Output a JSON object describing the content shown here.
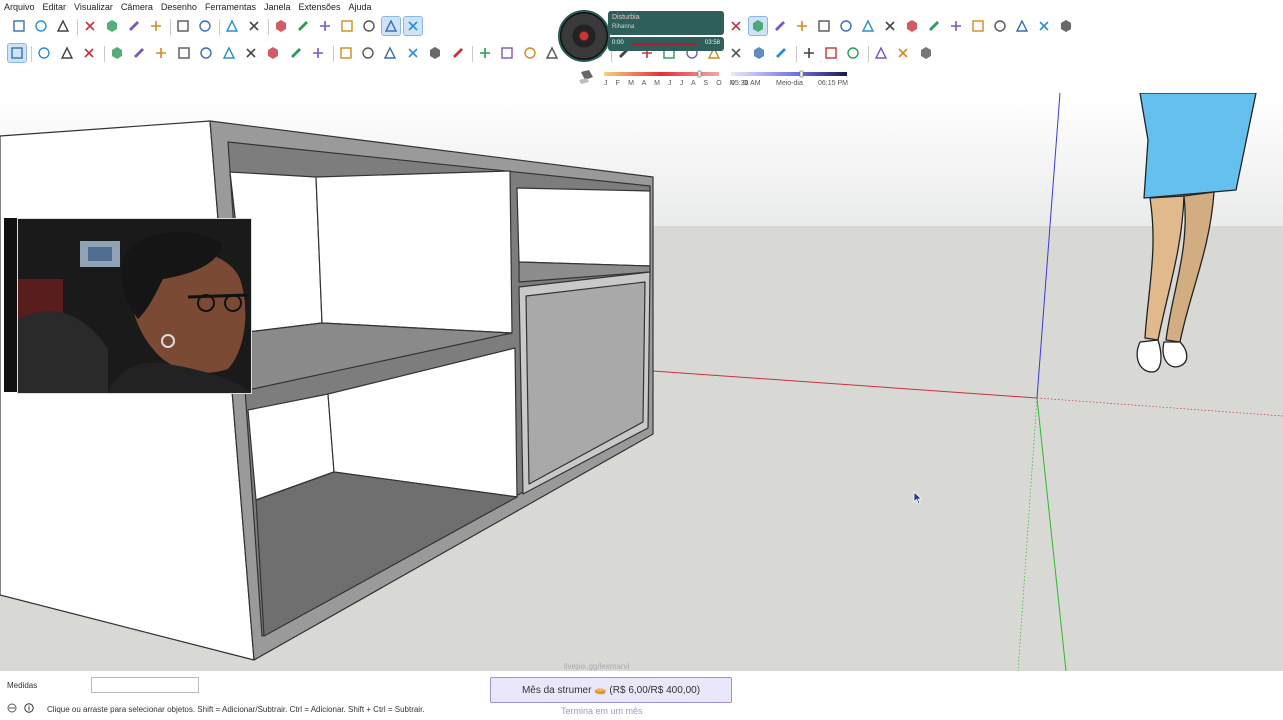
{
  "menu": [
    "Arquivo",
    "Editar",
    "Visualizar",
    "Câmera",
    "Desenho",
    "Ferramentas",
    "Janela",
    "Extensões",
    "Ajuda"
  ],
  "music": {
    "title": "Disturbia",
    "artist": "Rihanna",
    "time_start": "0:00",
    "time_end": "03:58"
  },
  "shadow": {
    "months": "J F M A M J J A S O N D",
    "time_start": "05:38 AM",
    "time_mid": "Meio-dia",
    "time_end": "06:15 PM"
  },
  "status": {
    "measure_label": "Medidas",
    "hint": "Clique ou arraste para selecionar objetos. Shift = Adicionar/Subtrair. Ctrl = Adicionar. Shift + Ctrl = Subtrair."
  },
  "donation": {
    "url": "livepix.gg/lexmarvl",
    "goal": "Mês da strumer 🥧 (R$ 6,00/R$ 400,00)",
    "goal_sub": "Termina em um mês"
  },
  "colors": {
    "red_axis": "#c8323c",
    "green_axis": "#2eb82e",
    "blue_axis": "#3a3ad8",
    "accent": "#cfe3f7"
  },
  "icons": {
    "toolbar_row1": [
      "new-file-icon",
      "open-folder-icon",
      "save-icon",
      "cut-icon",
      "copy-icon",
      "paste-icon",
      "erase-icon",
      "undo-icon",
      "redo-icon",
      "print-icon",
      "model-info-icon",
      "iso-view-icon",
      "top-view-icon",
      "front-view-icon",
      "right-view-icon",
      "back-view-icon",
      "left-view-icon",
      "bottom-view-icon",
      "orbit-icon",
      "pan-icon",
      "zoom-extents-icon",
      "section-icon",
      "geo-icon",
      "layers-icon",
      "components-icon",
      "add-location-icon",
      "terrain-icon",
      "warehouse-icon",
      "extension-warehouse-icon",
      "settings-icon",
      "styles-icon",
      "info-icon",
      "cart-icon",
      "account-icon"
    ],
    "toolbar_row2": [
      "select-icon",
      "component-icon",
      "paint-bucket-icon",
      "eraser-icon",
      "pencil-icon",
      "freehand-icon",
      "rectangle-icon",
      "rotated-rectangle-icon",
      "circle-icon",
      "polygon-icon",
      "arc-icon",
      "two-point-arc-icon",
      "three-point-arc-icon",
      "pie-icon",
      "move-icon",
      "push-pull-icon",
      "rotate-icon",
      "follow-me-icon",
      "scale-icon",
      "offset-icon",
      "tape-measure-icon",
      "dimension-icon",
      "protractor-icon",
      "text-icon",
      "axes-icon",
      "3d-text-icon",
      "orbit-tool-icon",
      "pan-tool-icon",
      "zoom-tool-icon",
      "zoom-window-icon",
      "zoom-extents-tool-icon",
      "position-camera-icon",
      "look-around-icon",
      "walk-icon",
      "section-plane-icon",
      "xray-icon",
      "solid-tools-icon",
      "sandbox-icon",
      "hidden-line-icon",
      "shaded-icon"
    ]
  }
}
